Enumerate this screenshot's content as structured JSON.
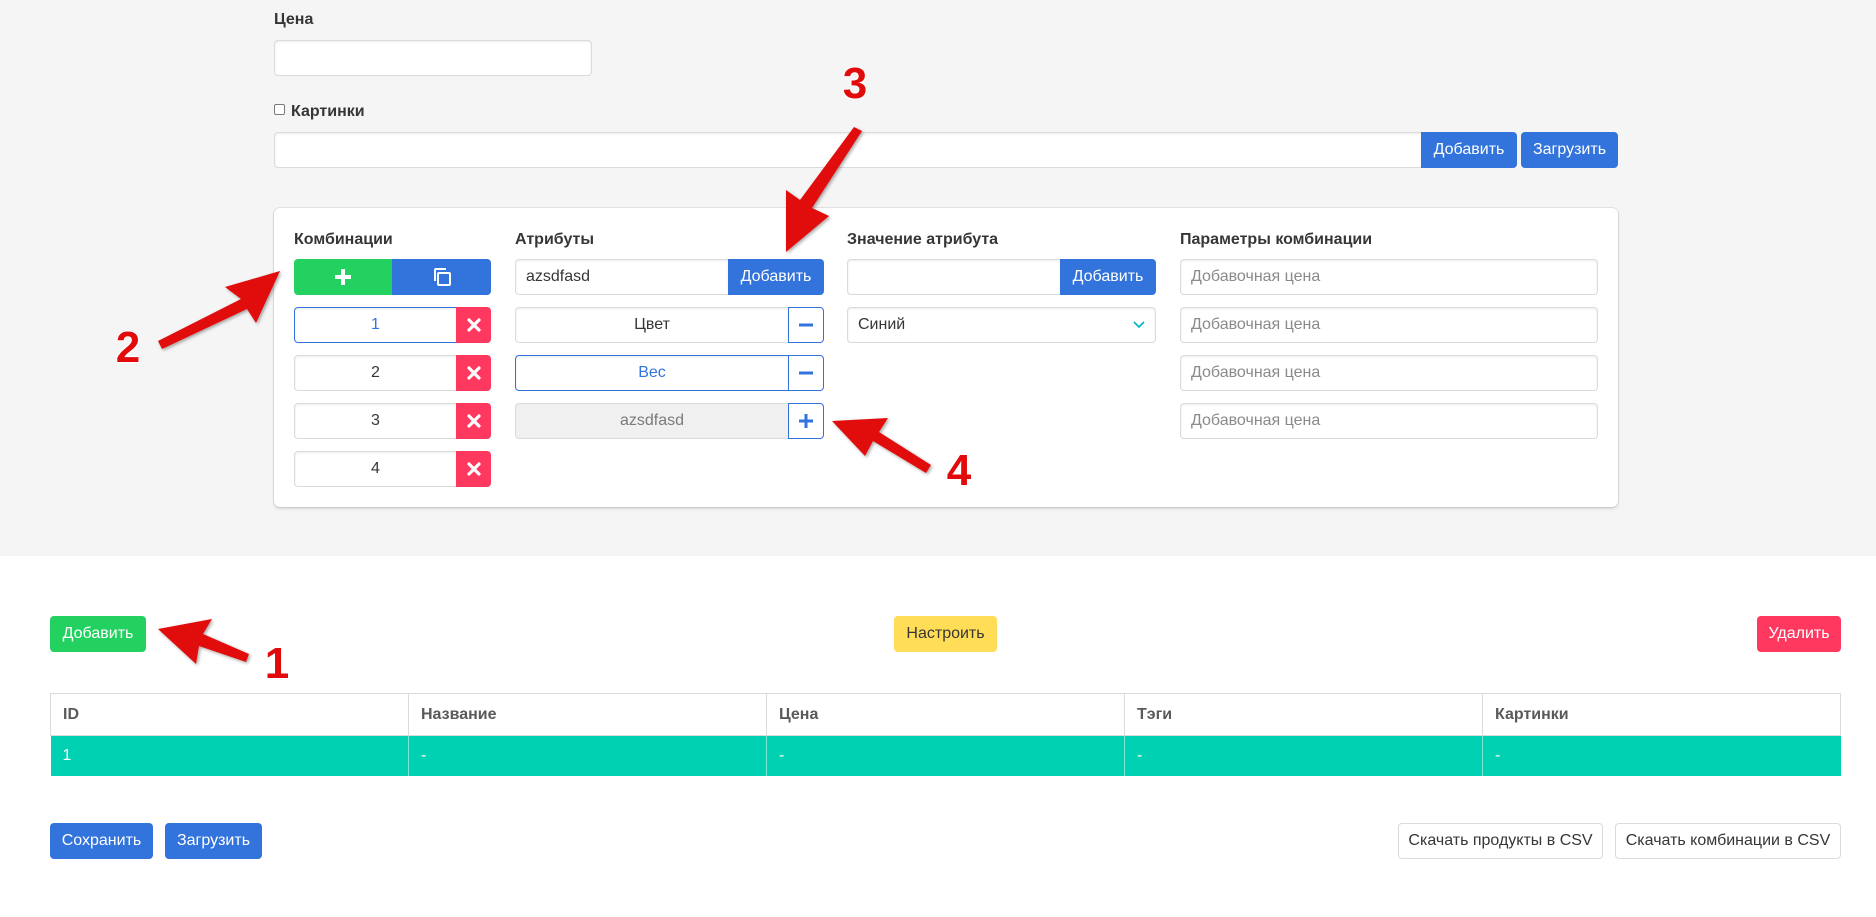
{
  "form": {
    "price_label": "Цена",
    "price_value": "",
    "images_label": "Картинки",
    "images_value": "",
    "images_add": "Добавить",
    "images_upload": "Загрузить"
  },
  "combinations": {
    "title": "Комбинации",
    "items": [
      "1",
      "2",
      "3",
      "4"
    ]
  },
  "attributes": {
    "title": "Атрибуты",
    "input_value": "azsdfasd",
    "add_label": "Добавить",
    "items": [
      "Цвет",
      "Вес",
      "azsdfasd"
    ]
  },
  "attr_value": {
    "title": "Значение атрибута",
    "input_value": "",
    "add_label": "Добавить",
    "select_value": "Синий"
  },
  "params": {
    "title": "Параметры комбинации",
    "placeholders": [
      "Добавочная цена",
      "Добавочная цена",
      "Добавочная цена",
      "Добавочная цена"
    ]
  },
  "toolbar": {
    "add": "Добавить",
    "configure": "Настроить",
    "delete": "Удалить"
  },
  "table": {
    "headers": [
      "ID",
      "Название",
      "Цена",
      "Тэги",
      "Картинки"
    ],
    "rows": [
      [
        "1",
        "-",
        "-",
        "-",
        "-"
      ]
    ]
  },
  "footer": {
    "save": "Сохранить",
    "upload": "Загрузить",
    "csv_products": "Скачать продукты в CSV",
    "csv_combinations": "Скачать комбинации в CSV"
  },
  "annotations": [
    "1",
    "2",
    "3",
    "4"
  ],
  "colors": {
    "primary": "#3273dc",
    "success": "#23d160",
    "danger": "#ff3860",
    "warning": "#ffdd57",
    "teal_row": "#00d1b2",
    "annotation": "#e10b0b"
  }
}
